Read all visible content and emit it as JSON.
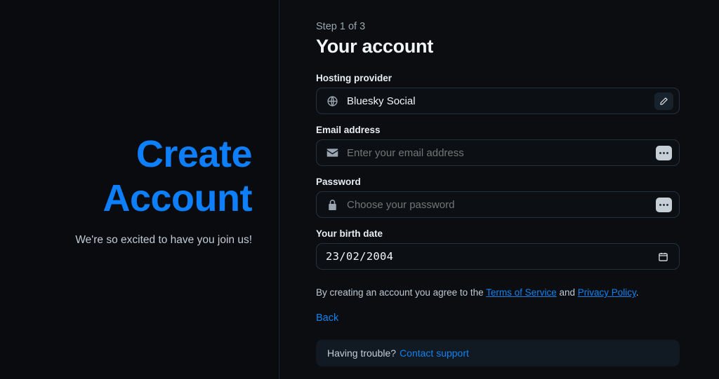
{
  "brand": {
    "title_line1": "Create",
    "title_line2": "Account",
    "subtitle": "We're so excited to have you join us!",
    "accent_color": "#0d7ffb"
  },
  "form": {
    "step_label": "Step 1 of 3",
    "title": "Your account",
    "hosting": {
      "label": "Hosting provider",
      "value": "Bluesky Social",
      "icon": "globe-icon",
      "action_icon": "pencil-icon"
    },
    "email": {
      "label": "Email address",
      "value": "",
      "placeholder": "Enter your email address",
      "icon": "envelope-icon",
      "action_icon": "autofill-dots-icon"
    },
    "password": {
      "label": "Password",
      "value": "",
      "placeholder": "Choose your password",
      "icon": "lock-icon",
      "action_icon": "autofill-dots-icon"
    },
    "birthdate": {
      "label": "Your birth date",
      "value": "23/02/2004",
      "action_icon": "calendar-icon"
    },
    "legal": {
      "prefix": "By creating an account you agree to the ",
      "terms_link": "Terms of Service",
      "conjunction": " and ",
      "privacy_link": "Privacy Policy",
      "suffix": "."
    },
    "back_label": "Back",
    "support": {
      "text": "Having trouble?",
      "link": "Contact support"
    }
  }
}
